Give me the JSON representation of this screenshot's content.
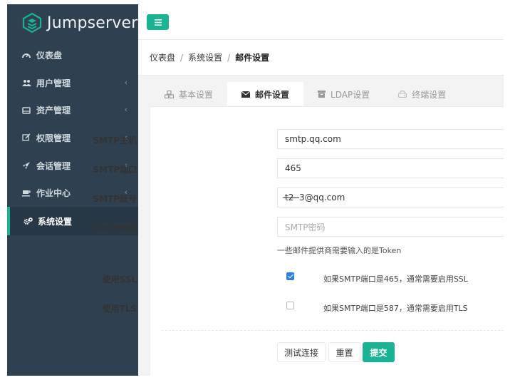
{
  "brand": {
    "name": "Jumpserver",
    "accent": "#1ab394",
    "sidebar_bg": "#2f4050"
  },
  "sidebar": {
    "items": [
      {
        "label": "仪表盘",
        "icon": "dashboard-icon",
        "has_children": false
      },
      {
        "label": "用户管理",
        "icon": "users-icon",
        "has_children": true
      },
      {
        "label": "资产管理",
        "icon": "inbox-icon",
        "has_children": true
      },
      {
        "label": "权限管理",
        "icon": "edit-icon",
        "has_children": true
      },
      {
        "label": "会话管理",
        "icon": "rocket-icon",
        "has_children": true
      },
      {
        "label": "作业中心",
        "icon": "coffee-icon",
        "has_children": true
      },
      {
        "label": "系统设置",
        "icon": "gears-icon",
        "has_children": false,
        "active": true
      }
    ]
  },
  "breadcrumb": [
    "仪表盘",
    "系统设置",
    "邮件设置"
  ],
  "tabs": [
    {
      "label": "基本设置",
      "icon": "cubes-icon"
    },
    {
      "label": "邮件设置",
      "icon": "envelope-icon",
      "active": true
    },
    {
      "label": "LDAP设置",
      "icon": "archive-icon"
    },
    {
      "label": "终端设置",
      "icon": "hdd-icon"
    }
  ],
  "form": {
    "host": {
      "label": "SMTP主机",
      "value": "smtp.qq.com"
    },
    "port": {
      "label": "SMTP端口",
      "value": "465"
    },
    "user": {
      "label": "SMTP账号",
      "value": "t̶2̶ ̶̶̶̶ ̶̶̶3@qq.com"
    },
    "password": {
      "label": "SMTP密码",
      "placeholder": "SMTP密码",
      "help": "一些邮件提供商需要输入的是Token"
    },
    "ssl": {
      "label": "使用SSL",
      "checked": true,
      "hint": "如果SMTP端口是465，通常需要启用SSL"
    },
    "tls": {
      "label": "使用TLS",
      "checked": false,
      "hint": "如果SMTP端口是587，通常需要启用TLS"
    }
  },
  "buttons": {
    "test": "测试连接",
    "reset": "重置",
    "submit": "提交"
  }
}
